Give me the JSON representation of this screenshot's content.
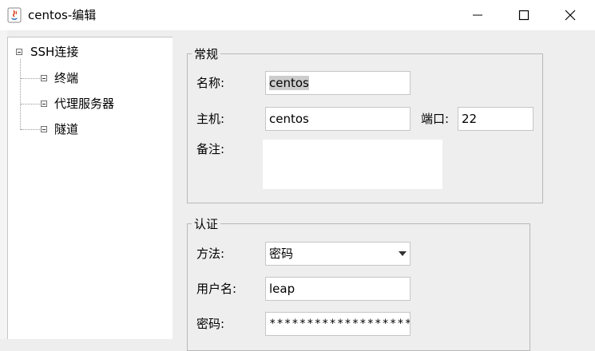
{
  "window": {
    "title": "centos-编辑"
  },
  "tree": {
    "root": "SSH连接",
    "children": [
      "终端",
      "代理服务器",
      "隧道"
    ]
  },
  "general": {
    "legend": "常规",
    "name_label": "名称:",
    "name_value": "centos",
    "host_label": "主机:",
    "host_value": "centos",
    "port_label": "端口:",
    "port_value": "22",
    "note_label": "备注:"
  },
  "auth": {
    "legend": "认证",
    "method_label": "方法:",
    "method_value": "密码",
    "user_label": "用户名:",
    "user_value": "leap",
    "password_label": "密码:",
    "password_value": "**********************"
  }
}
